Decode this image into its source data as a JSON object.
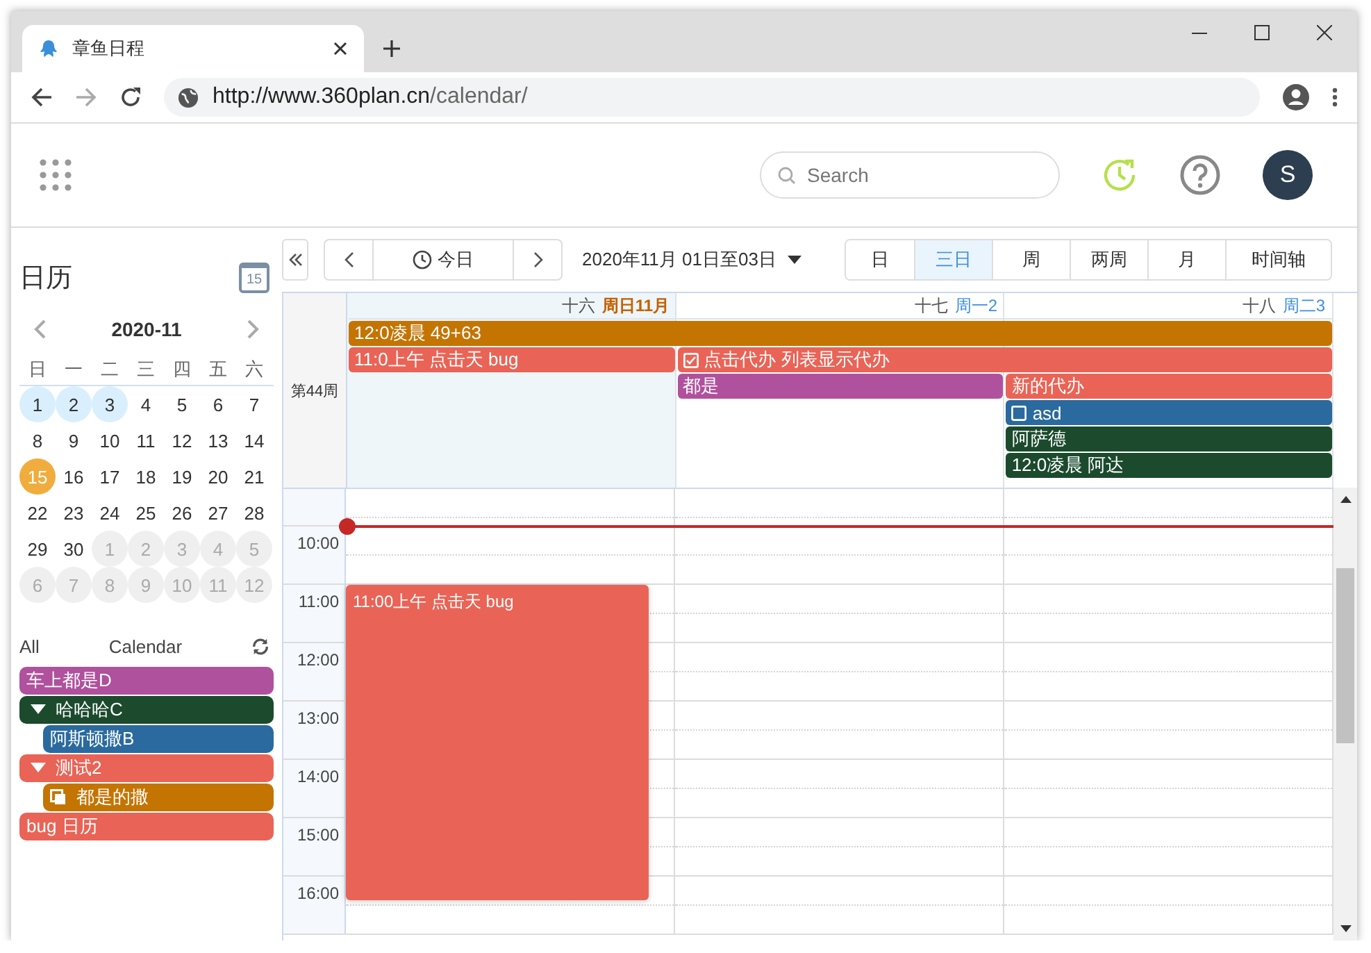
{
  "browser": {
    "tab_title": "章鱼日程",
    "url_host": "http://www.360plan.cn",
    "url_path": "/calendar/"
  },
  "header": {
    "search": {
      "placeholder": "Search"
    },
    "avatar": "S"
  },
  "sidebar": {
    "title": "日历",
    "calendar_icon_day": "15",
    "month": "2020-11",
    "weekdays": [
      "日",
      "一",
      "二",
      "三",
      "四",
      "五",
      "六"
    ],
    "days": [
      {
        "label": "1",
        "muted": false,
        "selected": true,
        "today": false
      },
      {
        "label": "2",
        "muted": false,
        "selected": true,
        "today": false
      },
      {
        "label": "3",
        "muted": false,
        "selected": true,
        "today": false
      },
      {
        "label": "4",
        "muted": false,
        "selected": false,
        "today": false
      },
      {
        "label": "5",
        "muted": false,
        "selected": false,
        "today": false
      },
      {
        "label": "6",
        "muted": false,
        "selected": false,
        "today": false
      },
      {
        "label": "7",
        "muted": false,
        "selected": false,
        "today": false
      },
      {
        "label": "8",
        "muted": false,
        "selected": false,
        "today": false
      },
      {
        "label": "9",
        "muted": false,
        "selected": false,
        "today": false
      },
      {
        "label": "10",
        "muted": false,
        "selected": false,
        "today": false
      },
      {
        "label": "11",
        "muted": false,
        "selected": false,
        "today": false
      },
      {
        "label": "12",
        "muted": false,
        "selected": false,
        "today": false
      },
      {
        "label": "13",
        "muted": false,
        "selected": false,
        "today": false
      },
      {
        "label": "14",
        "muted": false,
        "selected": false,
        "today": false
      },
      {
        "label": "15",
        "muted": false,
        "selected": false,
        "today": true
      },
      {
        "label": "16",
        "muted": false,
        "selected": false,
        "today": false
      },
      {
        "label": "17",
        "muted": false,
        "selected": false,
        "today": false
      },
      {
        "label": "18",
        "muted": false,
        "selected": false,
        "today": false
      },
      {
        "label": "19",
        "muted": false,
        "selected": false,
        "today": false
      },
      {
        "label": "20",
        "muted": false,
        "selected": false,
        "today": false
      },
      {
        "label": "21",
        "muted": false,
        "selected": false,
        "today": false
      },
      {
        "label": "22",
        "muted": false,
        "selected": false,
        "today": false
      },
      {
        "label": "23",
        "muted": false,
        "selected": false,
        "today": false
      },
      {
        "label": "24",
        "muted": false,
        "selected": false,
        "today": false
      },
      {
        "label": "25",
        "muted": false,
        "selected": false,
        "today": false
      },
      {
        "label": "26",
        "muted": false,
        "selected": false,
        "today": false
      },
      {
        "label": "27",
        "muted": false,
        "selected": false,
        "today": false
      },
      {
        "label": "28",
        "muted": false,
        "selected": false,
        "today": false
      },
      {
        "label": "29",
        "muted": false,
        "selected": false,
        "today": false
      },
      {
        "label": "30",
        "muted": false,
        "selected": false,
        "today": false
      },
      {
        "label": "1",
        "muted": true,
        "selected": false,
        "today": false
      },
      {
        "label": "2",
        "muted": true,
        "selected": false,
        "today": false
      },
      {
        "label": "3",
        "muted": true,
        "selected": false,
        "today": false
      },
      {
        "label": "4",
        "muted": true,
        "selected": false,
        "today": false
      },
      {
        "label": "5",
        "muted": true,
        "selected": false,
        "today": false
      },
      {
        "label": "6",
        "muted": true,
        "selected": false,
        "today": false
      },
      {
        "label": "7",
        "muted": true,
        "selected": false,
        "today": false
      },
      {
        "label": "8",
        "muted": true,
        "selected": false,
        "today": false
      },
      {
        "label": "9",
        "muted": true,
        "selected": false,
        "today": false
      },
      {
        "label": "10",
        "muted": true,
        "selected": false,
        "today": false
      },
      {
        "label": "11",
        "muted": true,
        "selected": false,
        "today": false
      },
      {
        "label": "12",
        "muted": true,
        "selected": false,
        "today": false
      }
    ],
    "filter": {
      "all": "All",
      "label": "Calendar"
    },
    "calendars": [
      {
        "name": "车上都是D",
        "color": "#b0519d",
        "kind": "plain"
      },
      {
        "name": "哈哈哈C",
        "color": "#1b4a2d",
        "kind": "group",
        "expanded": true,
        "children": [
          {
            "name": "阿斯顿撒B",
            "color": "#2a6a9e",
            "kind": "plain"
          }
        ]
      },
      {
        "name": "测试2",
        "color": "#e96456",
        "kind": "group",
        "expanded": true,
        "children": [
          {
            "name": "都是的撒",
            "color": "#c47400",
            "kind": "shared"
          }
        ]
      },
      {
        "name": "bug 日历",
        "color": "#e96456",
        "kind": "plain"
      }
    ]
  },
  "toolbar": {
    "today": "今日",
    "range": "2020年11月 01日至03日",
    "views": [
      {
        "label": "日",
        "selected": false
      },
      {
        "label": "三日",
        "selected": true
      },
      {
        "label": "周",
        "selected": false
      },
      {
        "label": "两周",
        "selected": false
      },
      {
        "label": "月",
        "selected": false
      },
      {
        "label": "时间轴",
        "selected": false
      }
    ]
  },
  "grid": {
    "week": "第44周",
    "days": [
      {
        "lunar": "十六",
        "label": "周日11月",
        "today": true
      },
      {
        "lunar": "十七",
        "label": "周一2",
        "today": false
      },
      {
        "lunar": "十八",
        "label": "周二3",
        "today": false
      }
    ],
    "allday_rows": [
      [
        {
          "kind": "event",
          "title": "12:0凌晨 49+63",
          "color": "#c47400"
        },
        {
          "kind": "continued"
        },
        {
          "kind": "continued"
        }
      ],
      [
        {
          "kind": "event",
          "title": "11:0上午 点击天 bug",
          "color": "#e96456"
        },
        {
          "kind": "todo",
          "title": "点击代办 列表显示代办",
          "color": "#e96456",
          "checked": true
        },
        {
          "kind": "continued"
        }
      ],
      [
        {
          "kind": "empty"
        },
        {
          "kind": "event",
          "title": "都是",
          "color": "#b0519d"
        },
        {
          "kind": "event",
          "title": "新的代办",
          "color": "#e96456"
        }
      ],
      [
        {
          "kind": "empty"
        },
        {
          "kind": "empty"
        },
        {
          "kind": "todo",
          "title": "asd",
          "color": "#2a6a9e",
          "checked": false
        }
      ],
      [
        {
          "kind": "empty"
        },
        {
          "kind": "empty"
        },
        {
          "kind": "event",
          "title": "阿萨德",
          "color": "#1b4a2d"
        }
      ],
      [
        {
          "kind": "empty"
        },
        {
          "kind": "empty"
        },
        {
          "kind": "event",
          "title": "12:0凌晨 阿达",
          "color": "#1b4a2d"
        }
      ]
    ],
    "hours": [
      {
        "label": "10:00",
        "now": true
      },
      {
        "label": "11:00",
        "now": false,
        "events": [
          {
            "title": "11:00上午 点击天 bug",
            "color": "#e96456"
          }
        ]
      },
      {
        "label": "12:00",
        "now": false
      },
      {
        "label": "13:00",
        "now": false
      },
      {
        "label": "14:00",
        "now": false
      },
      {
        "label": "15:00",
        "now": false
      },
      {
        "label": "16:00",
        "now": false
      }
    ]
  }
}
